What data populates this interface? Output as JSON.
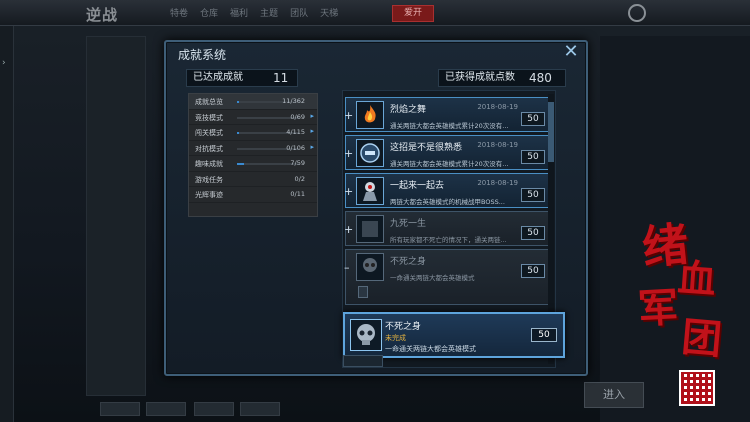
{
  "background": {
    "logo": "逆战",
    "menu": [
      "特卷",
      "仓库",
      "福利",
      "主题",
      "团队",
      "天梯"
    ],
    "red_button": "爱开",
    "enter_button": "进入"
  },
  "modal": {
    "title": "成就系统",
    "achieved_label": "已达成成就",
    "achieved_value": "11",
    "points_label": "已获得成就点数",
    "points_value": "480"
  },
  "categories": [
    {
      "name": "成就总览",
      "count": "11/362",
      "progress": 0.03
    },
    {
      "name": "竞技模式",
      "count": "0/69",
      "progress": 0.0
    },
    {
      "name": "闯关模式",
      "count": "4/115",
      "progress": 0.03
    },
    {
      "name": "对抗模式",
      "count": "0/106",
      "progress": 0.0
    },
    {
      "name": "趣味成就",
      "count": "7/59",
      "progress": 0.12
    },
    {
      "name": "游戏任务",
      "count": "0/2",
      "progress": 0.0
    },
    {
      "name": "光辉事迹",
      "count": "0/11",
      "progress": 0.0
    }
  ],
  "achievements": [
    {
      "name": "烈焰之舞",
      "date": "2018-08-19",
      "desc": "通关两链大都会英雄模式累计20次没有...",
      "points": "50"
    },
    {
      "name": "这招是不是很熟悉",
      "date": "2018-08-19",
      "desc": "通关两链大都会英雄模式累计20次没有...",
      "points": "50"
    },
    {
      "name": "一起来一起去",
      "date": "2018-08-19",
      "desc": "两链大都会英雄模式的机械战甲BOSS...",
      "points": "50"
    },
    {
      "name": "九死一生",
      "date": "",
      "desc": "所有玩家都不死亡的情况下，通关两链...",
      "points": "50"
    },
    {
      "name": "不死之身",
      "date": "",
      "desc": "一命通关两链大都会英雄模式",
      "points": "50"
    }
  ],
  "tooltip": {
    "name": "不死之身",
    "status": "未完成",
    "desc": "一命通关两链大都会英雄模式",
    "points": "50"
  },
  "colors": {
    "accent": "#5ea4dc",
    "logo_red": "#c1121a",
    "incomplete": "#e0b040"
  },
  "logo_text": [
    "绪",
    "血",
    "军",
    "团"
  ]
}
